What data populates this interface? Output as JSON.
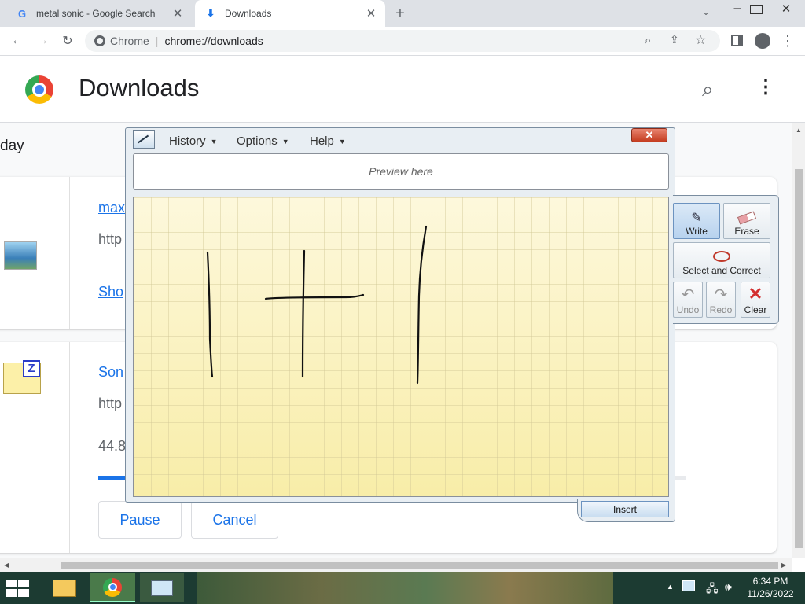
{
  "tabs": [
    {
      "title": "metal sonic - Google Search",
      "icon": "google-g-icon"
    },
    {
      "title": "Downloads",
      "icon": "download-icon"
    }
  ],
  "omnibox": {
    "scheme": "Chrome",
    "separator": "|",
    "url": "chrome://downloads"
  },
  "page": {
    "title": "Downloads",
    "section": "day"
  },
  "downloads": [
    {
      "name": "max",
      "url": "http",
      "action": "Sho"
    },
    {
      "name": "Son",
      "url": "http",
      "size": "44.8",
      "progress": 0.4,
      "pause_label": "Pause",
      "cancel_label": "Cancel"
    }
  ],
  "tip": {
    "menus": [
      "History",
      "Options",
      "Help"
    ],
    "close": "✕",
    "preview": "Preview here",
    "tools": {
      "write": "Write",
      "erase": "Erase",
      "select": "Select and Correct",
      "undo": "Undo",
      "redo": "Redo",
      "clear": "Clear"
    },
    "insert": "Insert"
  },
  "taskbar": {
    "time": "6:34 PM",
    "date": "11/26/2022"
  },
  "colors": {
    "accent": "#1a73e8",
    "taskbar": "#1c3b32",
    "pad": "#fcf3c7"
  }
}
